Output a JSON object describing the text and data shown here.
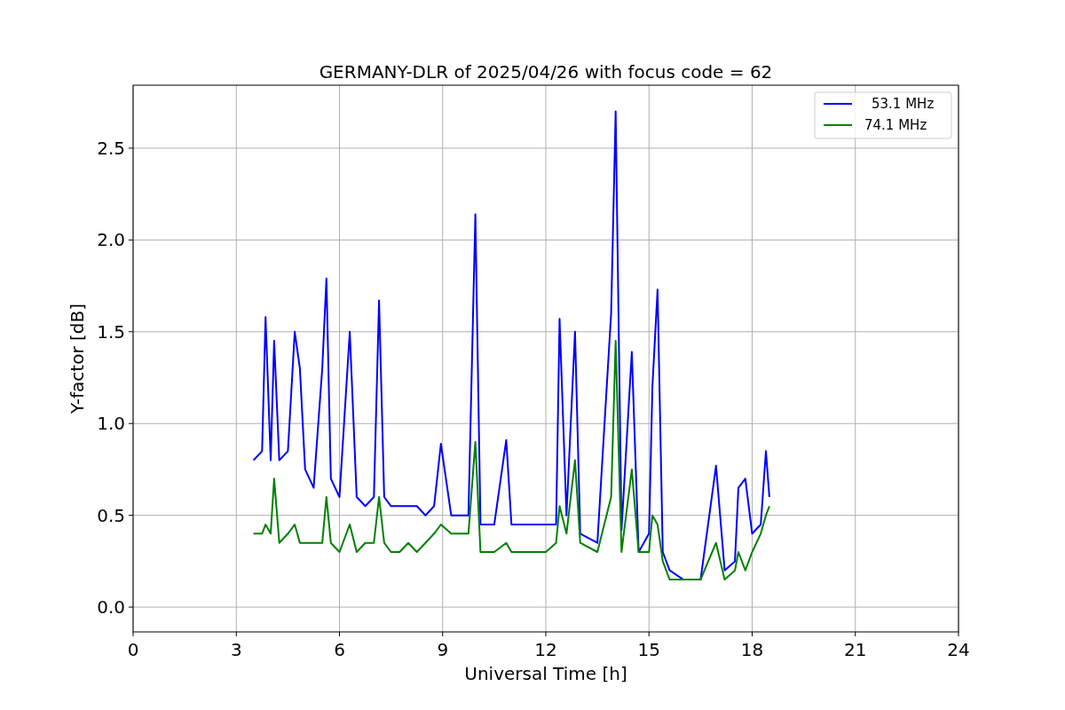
{
  "chart_data": {
    "type": "line",
    "title": "GERMANY-DLR of 2025/04/26 with focus code = 62",
    "xlabel": "Universal Time [h]",
    "ylabel": "Y-factor [dB]",
    "x": [
      3.5,
      3.75,
      3.85,
      4.0,
      4.1,
      4.25,
      4.5,
      4.7,
      4.85,
      5.0,
      5.25,
      5.5,
      5.62,
      5.75,
      6.0,
      6.3,
      6.5,
      6.75,
      7.0,
      7.15,
      7.3,
      7.5,
      7.75,
      8.0,
      8.25,
      8.5,
      8.75,
      8.95,
      9.25,
      9.5,
      9.75,
      9.95,
      10.1,
      10.5,
      10.85,
      11.0,
      11.5,
      12.0,
      12.3,
      12.4,
      12.6,
      12.85,
      13.0,
      13.5,
      13.9,
      14.03,
      14.2,
      14.5,
      14.7,
      15.0,
      15.1,
      15.25,
      15.4,
      15.6,
      16.0,
      16.5,
      16.95,
      17.2,
      17.5,
      17.6,
      17.8,
      18.0,
      18.25,
      18.4,
      18.5
    ],
    "series": [
      {
        "name": "53.1 MHz",
        "color": "#0000ff",
        "values": [
          0.8,
          0.85,
          1.58,
          0.8,
          1.45,
          0.8,
          0.85,
          1.5,
          1.3,
          0.75,
          0.65,
          1.3,
          1.79,
          0.7,
          0.6,
          1.5,
          0.6,
          0.55,
          0.6,
          1.67,
          0.6,
          0.55,
          0.55,
          0.55,
          0.55,
          0.5,
          0.55,
          0.89,
          0.5,
          0.5,
          0.5,
          2.14,
          0.45,
          0.45,
          0.91,
          0.45,
          0.45,
          0.45,
          0.45,
          1.57,
          0.5,
          1.5,
          0.4,
          0.35,
          1.6,
          2.7,
          0.42,
          1.39,
          0.3,
          0.4,
          1.2,
          1.73,
          0.3,
          0.2,
          0.15,
          0.15,
          0.77,
          0.2,
          0.25,
          0.65,
          0.7,
          0.4,
          0.45,
          0.85,
          0.6
        ]
      },
      {
        "name": "74.1 MHz",
        "color": "#008000",
        "values": [
          0.4,
          0.4,
          0.45,
          0.4,
          0.7,
          0.35,
          0.4,
          0.45,
          0.35,
          0.35,
          0.35,
          0.35,
          0.6,
          0.35,
          0.3,
          0.45,
          0.3,
          0.35,
          0.35,
          0.6,
          0.35,
          0.3,
          0.3,
          0.35,
          0.3,
          0.35,
          0.4,
          0.45,
          0.4,
          0.4,
          0.4,
          0.9,
          0.3,
          0.3,
          0.35,
          0.3,
          0.3,
          0.3,
          0.35,
          0.55,
          0.4,
          0.8,
          0.35,
          0.3,
          0.6,
          1.45,
          0.3,
          0.75,
          0.3,
          0.3,
          0.5,
          0.45,
          0.25,
          0.15,
          0.15,
          0.15,
          0.35,
          0.15,
          0.2,
          0.3,
          0.2,
          0.3,
          0.4,
          0.5,
          0.55
        ]
      }
    ],
    "grid": true,
    "legend": true,
    "xlim": [
      0,
      24
    ],
    "ylim": [
      -0.135,
      2.843
    ],
    "xticks": [
      0,
      3,
      6,
      9,
      12,
      15,
      18,
      21,
      24
    ],
    "yticks": [
      {
        "value": 0,
        "label": "0.0"
      },
      {
        "value": 0.5,
        "label": "0.5"
      },
      {
        "value": 1,
        "label": "1.0"
      },
      {
        "value": 1.5,
        "label": "1.5"
      },
      {
        "value": 2,
        "label": "2.0"
      },
      {
        "value": 2.5,
        "label": "2.5"
      }
    ]
  }
}
